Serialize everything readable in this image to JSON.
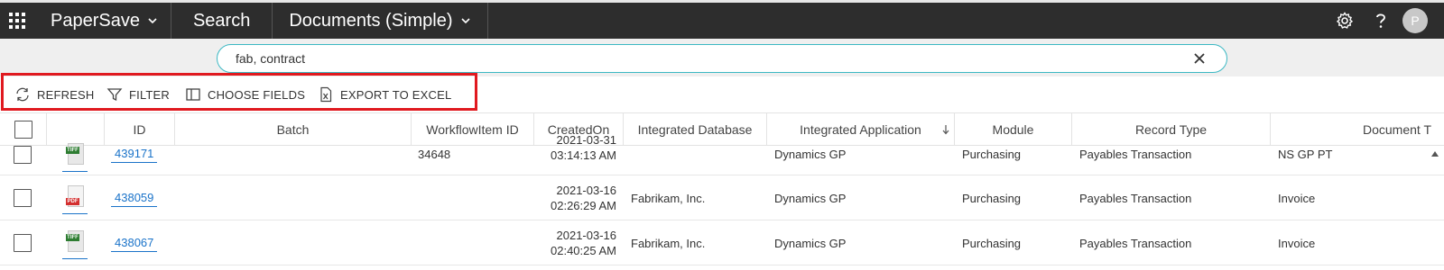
{
  "nav": {
    "brand": "PaperSave",
    "search": "Search",
    "view": "Documents (Simple)",
    "avatar_initial": "P"
  },
  "search": {
    "value": "fab, contract",
    "placeholder": ""
  },
  "toolbar": {
    "refresh": "REFRESH",
    "filter": "FILTER",
    "choose_fields": "CHOOSE FIELDS",
    "export": "EXPORT TO EXCEL"
  },
  "table": {
    "columns": [
      "ID",
      "Batch",
      "WorkflowItem ID",
      "CreatedOn",
      "Integrated Database",
      "Integrated Application",
      "Module",
      "Record Type",
      "Document T"
    ],
    "sorted_column": "Integrated Application",
    "rows": [
      {
        "file_type": "TIFF",
        "id": "439171",
        "batch": "",
        "workflow_item_id": "34648",
        "created_date": "2021-03-31",
        "created_time": "03:14:13 AM",
        "integrated_database": "",
        "integrated_application": "Dynamics GP",
        "module": "Purchasing",
        "record_type": "Payables Transaction",
        "document_type": "NS GP PT"
      },
      {
        "file_type": "PDF",
        "id": "438059",
        "batch": "",
        "workflow_item_id": "",
        "created_date": "2021-03-16",
        "created_time": "02:26:29 AM",
        "integrated_database": "Fabrikam, Inc.",
        "integrated_application": "Dynamics GP",
        "module": "Purchasing",
        "record_type": "Payables Transaction",
        "document_type": "Invoice"
      },
      {
        "file_type": "TIFF",
        "id": "438067",
        "batch": "",
        "workflow_item_id": "",
        "created_date": "2021-03-16",
        "created_time": "02:40:25 AM",
        "integrated_database": "Fabrikam, Inc.",
        "integrated_application": "Dynamics GP",
        "module": "Purchasing",
        "record_type": "Payables Transaction",
        "document_type": "Invoice"
      }
    ]
  },
  "colors": {
    "topbar": "#2d2d2d",
    "accent": "#3bb8c3",
    "link": "#1a73c9",
    "highlight": "#e0191f",
    "tiff": "#2e7d32",
    "pdf": "#d32f2f"
  }
}
